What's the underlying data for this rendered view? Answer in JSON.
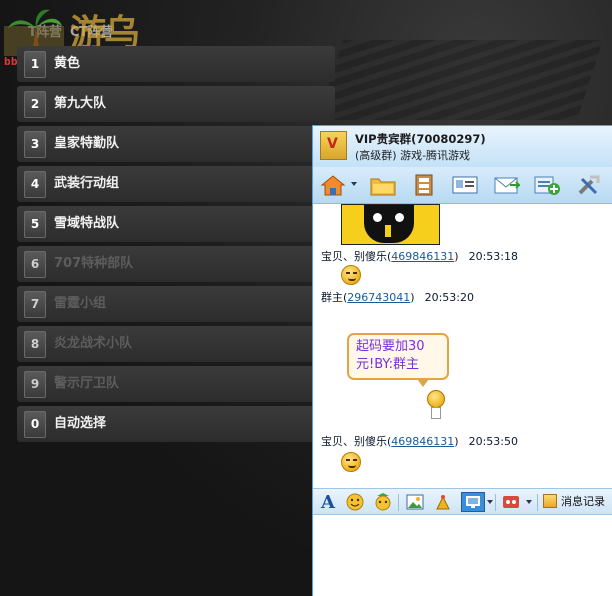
{
  "watermark": {
    "site_name": "游乌",
    "url": "bbs.youdao.com"
  },
  "top_tabs": [
    "T阵营",
    "CT阵营"
  ],
  "team_list": [
    {
      "number": "1",
      "label": "黄色",
      "dimmed": false
    },
    {
      "number": "2",
      "label": "第九大队",
      "dimmed": false
    },
    {
      "number": "3",
      "label": "皇家特勤队",
      "dimmed": false
    },
    {
      "number": "4",
      "label": "武装行动组",
      "dimmed": false
    },
    {
      "number": "5",
      "label": "雪域特战队",
      "dimmed": false
    },
    {
      "number": "6",
      "label": "707特种部队",
      "dimmed": true
    },
    {
      "number": "7",
      "label": "雷霆小组",
      "dimmed": true
    },
    {
      "number": "8",
      "label": "炎龙战术小队",
      "dimmed": true
    },
    {
      "number": "9",
      "label": "警示厅卫队",
      "dimmed": true
    },
    {
      "number": "0",
      "label": "自动选择",
      "dimmed": false
    }
  ],
  "qq_window": {
    "title": "VIP贵宾群(70080297)",
    "subtitle": "(高级群) 游戏-腾讯游戏",
    "toolbar_icons": [
      "home-icon",
      "folder-icon",
      "album-icon",
      "card-icon",
      "mail-icon",
      "add-icon",
      "tools-icon"
    ],
    "messages": [
      {
        "sender": "宝贝、别傻乐",
        "qq": "469846131",
        "time": "20:53:18"
      },
      {
        "sender": "群主",
        "qq": "296743041",
        "time": "20:53:20",
        "bubble_text": "起码要加30元!BY:群主"
      },
      {
        "sender": "宝贝、别傻乐",
        "qq": "469846131",
        "time": "20:53:50"
      }
    ],
    "input_toolbar": {
      "font_label": "A",
      "message_record_label": "消息记录"
    },
    "colors": {
      "border": "#5aa0d8",
      "header": "#c3e1f7",
      "bubble_text": "#7b2ee0",
      "bubble_border": "#e1a546"
    }
  }
}
